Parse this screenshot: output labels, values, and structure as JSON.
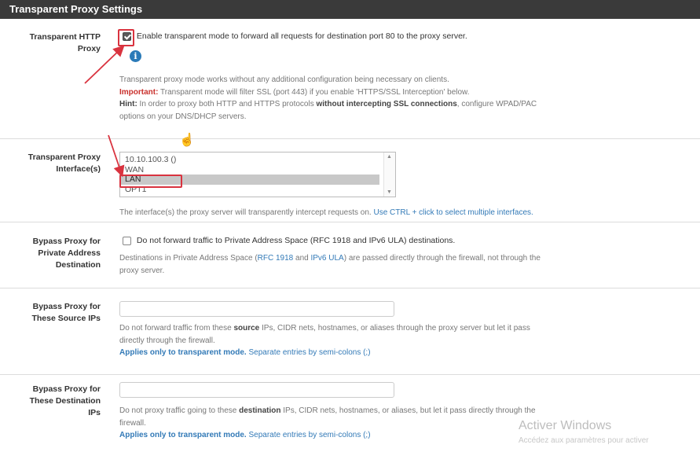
{
  "header": {
    "title": "Transparent Proxy Settings"
  },
  "transparent_http": {
    "label_line1": "Transparent HTTP",
    "label_line2": "Proxy",
    "checkbox_text": "Enable transparent mode to forward all requests for destination port 80 to the proxy server.",
    "checked": true,
    "info_icon": "i",
    "help_line1": "Transparent proxy mode works without any additional configuration being necessary on clients.",
    "important_label": "Important:",
    "important_text": " Transparent mode will filter SSL (port 443) if you enable 'HTTPS/SSL Interception' below.",
    "hint_label": "Hint:",
    "hint_text1": " In order to proxy both HTTP and HTTPS protocols ",
    "hint_strong": "without intercepting SSL connections",
    "hint_text2": ", configure WPAD/PAC",
    "hint_line2": "options on your DNS/DHCP servers."
  },
  "interfaces": {
    "label_line1": "Transparent Proxy",
    "label_line2": "Interface(s)",
    "options": [
      "10.10.100.3 ()",
      "WAN",
      "LAN",
      "OPT1"
    ],
    "selected": "LAN",
    "help_text": "The interface(s) the proxy server will transparently intercept requests on. ",
    "help_link": "Use CTRL + click to select multiple interfaces."
  },
  "bypass_private": {
    "label_line1": "Bypass Proxy for",
    "label_line2": "Private Address",
    "label_line3": "Destination",
    "checkbox_text": "Do not forward traffic to Private Address Space (RFC 1918 and IPv6 ULA) destinations.",
    "checked": false,
    "help_text1": "Destinations in Private Address Space (",
    "link_rfc": "RFC 1918",
    "help_and": " and ",
    "link_ula": "IPv6 ULA",
    "help_text2": ") are passed directly through the firewall, not through the",
    "help_line2": "proxy server."
  },
  "bypass_source": {
    "label_line1": "Bypass Proxy for",
    "label_line2": "These Source IPs",
    "value": "",
    "help_text1": "Do not forward traffic from these ",
    "help_strong": "source",
    "help_text2": " IPs, CIDR nets, hostnames, or aliases through the proxy server but let it pass",
    "help_line2": "directly through the firewall.",
    "applies_bold": "Applies only to transparent mode.",
    "applies_text": " Separate entries by semi-colons (;)"
  },
  "bypass_dest": {
    "label_line1": "Bypass Proxy for",
    "label_line2": "These Destination",
    "label_line3": "IPs",
    "value": "",
    "help_text1": "Do not proxy traffic going to these ",
    "help_strong": "destination",
    "help_text2": " IPs, CIDR nets, hostnames, or aliases, but let it pass directly through the",
    "help_line2": "firewall.",
    "applies_bold": "Applies only to transparent mode.",
    "applies_text": " Separate entries by semi-colons (;)"
  },
  "watermark": {
    "line1": "Activer Windows",
    "line2": "Accédez aux paramètres pour activer"
  },
  "colors": {
    "header_bg": "#3a3a3a",
    "link": "#337ab7",
    "important": "#c9302c",
    "annotation_red": "#d9333f"
  }
}
